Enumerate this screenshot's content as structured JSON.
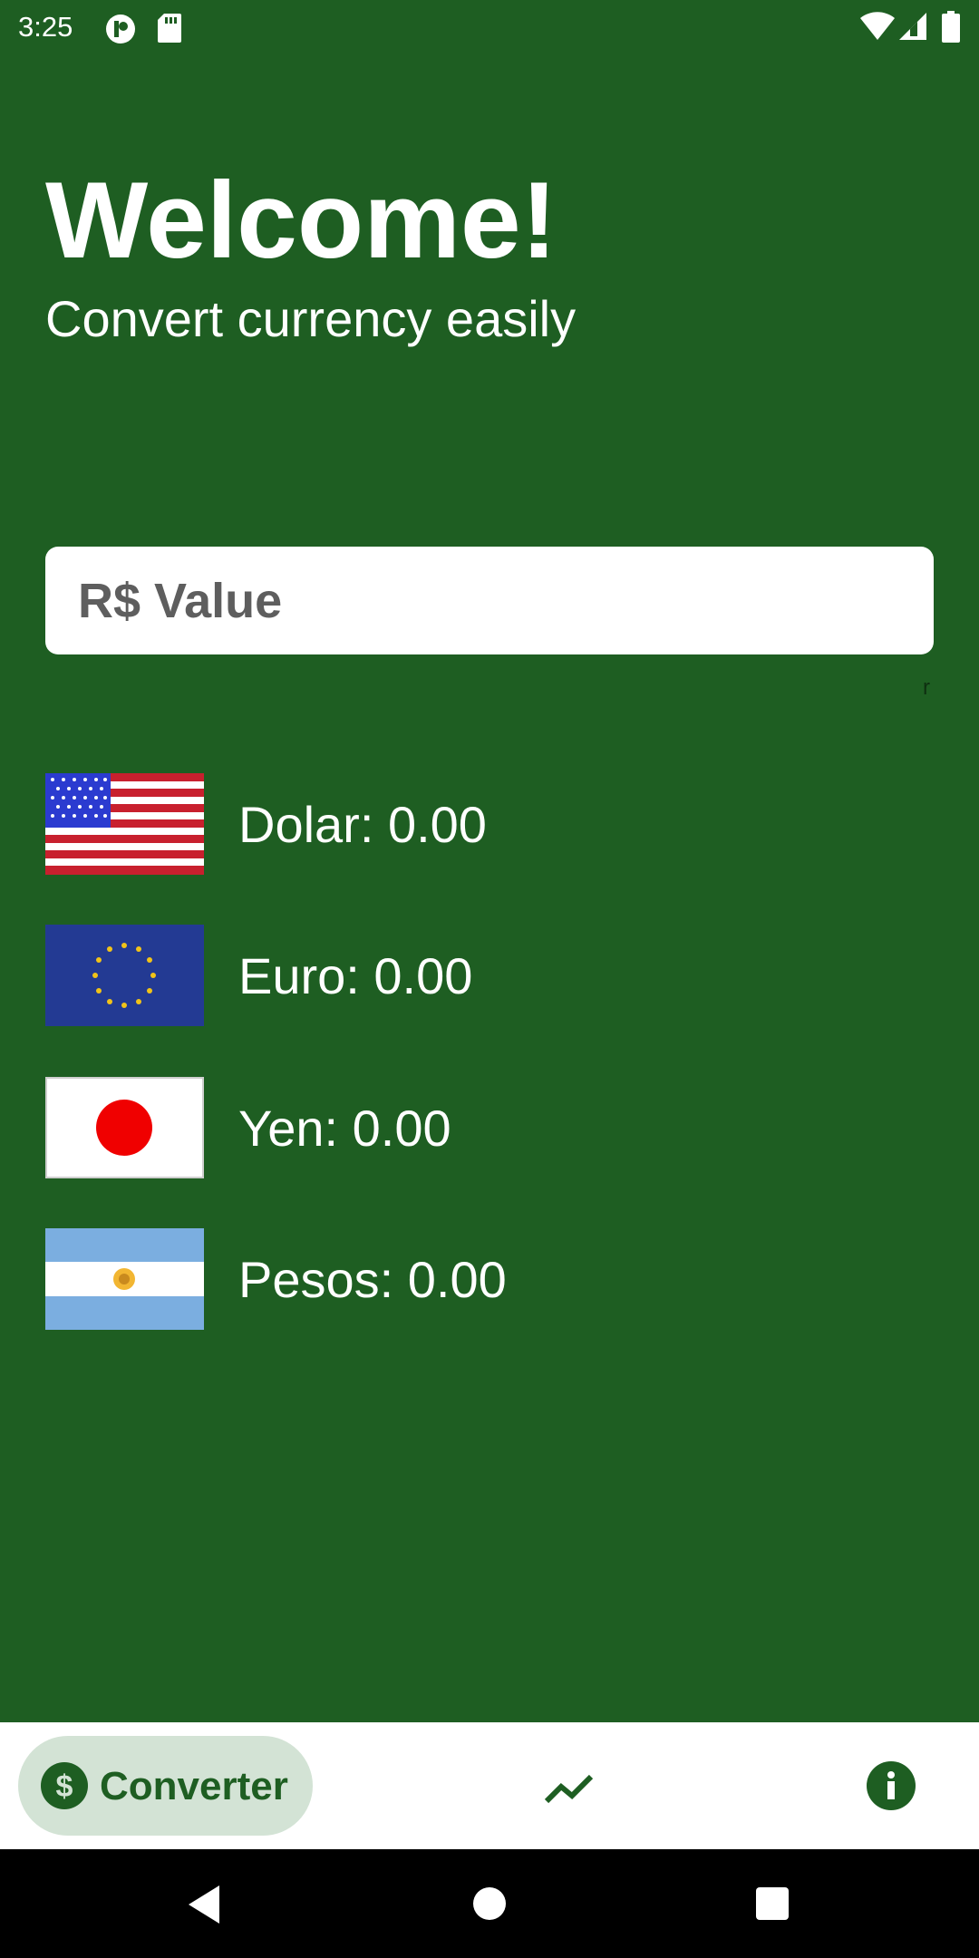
{
  "status_bar": {
    "time": "3:25",
    "left_icons": [
      "app-notification-icon",
      "sd-card-icon"
    ],
    "right_icons": [
      "wifi-icon",
      "cell-signal-icon",
      "battery-icon"
    ]
  },
  "header": {
    "title": "Welcome!",
    "subtitle": "Convert currency easily"
  },
  "input": {
    "placeholder": "R$ Value",
    "value": ""
  },
  "stray_text": "r",
  "currencies": [
    {
      "label": "Dolar: 0.00",
      "flag": "us-flag-icon"
    },
    {
      "label": "Euro: 0.00",
      "flag": "eu-flag-icon"
    },
    {
      "label": "Yen: 0.00",
      "flag": "japan-flag-icon"
    },
    {
      "label": "Pesos: 0.00",
      "flag": "argentina-flag-icon"
    }
  ],
  "bottom_nav": {
    "items": [
      {
        "label": "Converter",
        "icon": "dollar-icon",
        "selected": true
      },
      {
        "label": "",
        "icon": "trending-up-icon",
        "selected": false
      },
      {
        "label": "",
        "icon": "info-icon",
        "selected": false
      }
    ]
  },
  "system_nav": {
    "icons": [
      "back-icon",
      "home-icon",
      "recents-icon"
    ]
  },
  "colors": {
    "background": "#1E5E22",
    "accent": "#1E5E22",
    "nav_pill": "#D3E3D5",
    "input_text": "#5E5E5E"
  }
}
